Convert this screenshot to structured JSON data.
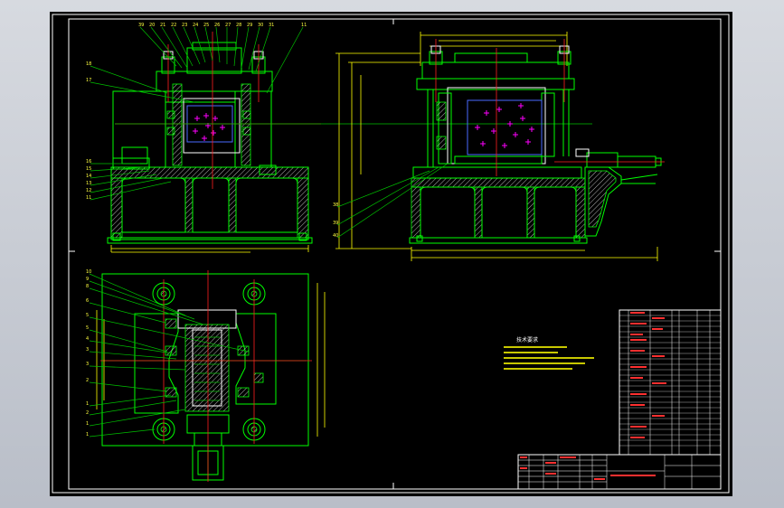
{
  "drawing": {
    "line_colors": {
      "background": "#000000",
      "outline": "#00ff00",
      "section": "#ffffff",
      "dimension": "#ffff00",
      "centerline": "#ff2020",
      "workpiece": "#ff00ff",
      "part": "#4a6aff"
    },
    "title_block": {
      "name_line1": "",
      "name_line2": "",
      "drawing_no": ""
    },
    "notes_title": "技术要求",
    "notes": [
      "",
      "",
      "",
      "",
      ""
    ]
  }
}
